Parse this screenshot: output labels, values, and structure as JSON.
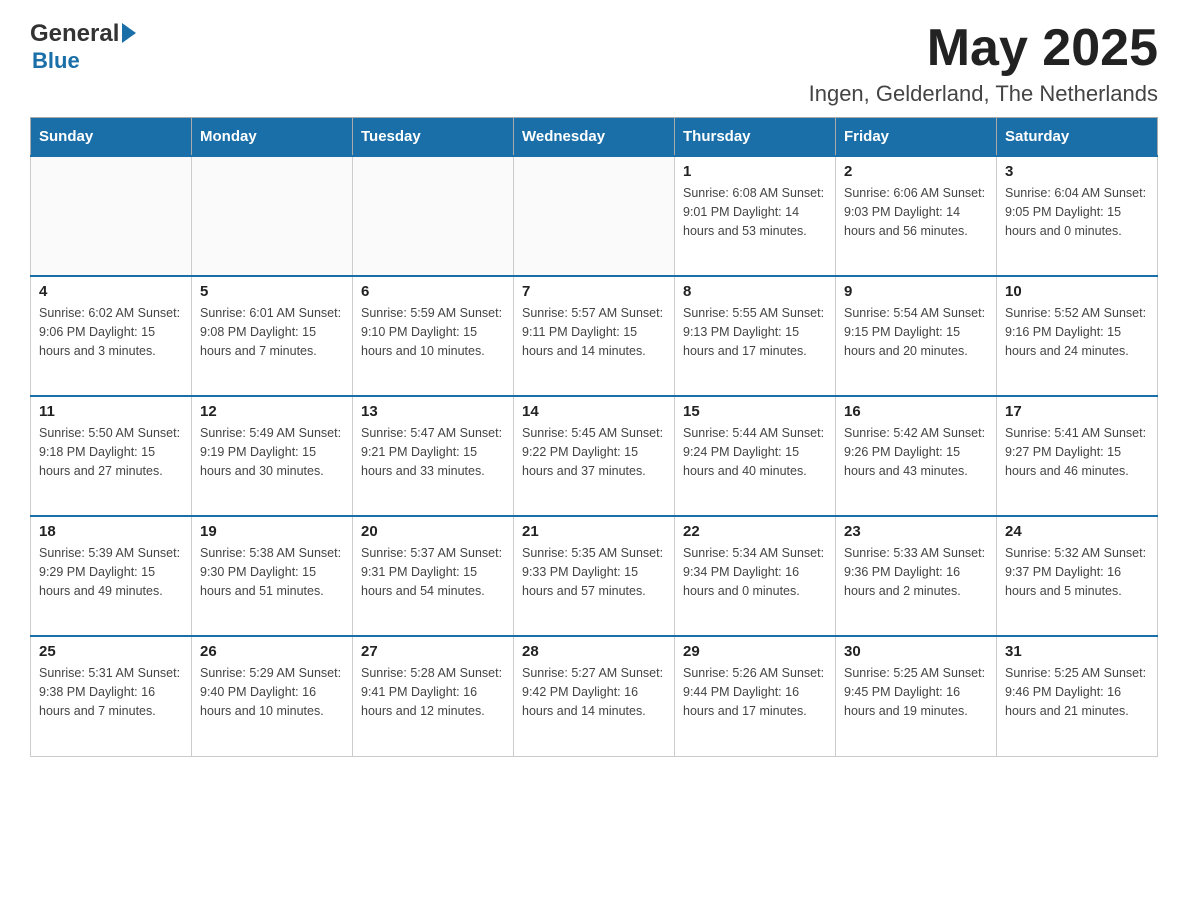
{
  "header": {
    "logo_general": "General",
    "logo_blue": "Blue",
    "title": "May 2025",
    "location": "Ingen, Gelderland, The Netherlands"
  },
  "days_of_week": [
    "Sunday",
    "Monday",
    "Tuesday",
    "Wednesday",
    "Thursday",
    "Friday",
    "Saturday"
  ],
  "weeks": [
    [
      {
        "day": "",
        "info": ""
      },
      {
        "day": "",
        "info": ""
      },
      {
        "day": "",
        "info": ""
      },
      {
        "day": "",
        "info": ""
      },
      {
        "day": "1",
        "info": "Sunrise: 6:08 AM\nSunset: 9:01 PM\nDaylight: 14 hours\nand 53 minutes."
      },
      {
        "day": "2",
        "info": "Sunrise: 6:06 AM\nSunset: 9:03 PM\nDaylight: 14 hours\nand 56 minutes."
      },
      {
        "day": "3",
        "info": "Sunrise: 6:04 AM\nSunset: 9:05 PM\nDaylight: 15 hours\nand 0 minutes."
      }
    ],
    [
      {
        "day": "4",
        "info": "Sunrise: 6:02 AM\nSunset: 9:06 PM\nDaylight: 15 hours\nand 3 minutes."
      },
      {
        "day": "5",
        "info": "Sunrise: 6:01 AM\nSunset: 9:08 PM\nDaylight: 15 hours\nand 7 minutes."
      },
      {
        "day": "6",
        "info": "Sunrise: 5:59 AM\nSunset: 9:10 PM\nDaylight: 15 hours\nand 10 minutes."
      },
      {
        "day": "7",
        "info": "Sunrise: 5:57 AM\nSunset: 9:11 PM\nDaylight: 15 hours\nand 14 minutes."
      },
      {
        "day": "8",
        "info": "Sunrise: 5:55 AM\nSunset: 9:13 PM\nDaylight: 15 hours\nand 17 minutes."
      },
      {
        "day": "9",
        "info": "Sunrise: 5:54 AM\nSunset: 9:15 PM\nDaylight: 15 hours\nand 20 minutes."
      },
      {
        "day": "10",
        "info": "Sunrise: 5:52 AM\nSunset: 9:16 PM\nDaylight: 15 hours\nand 24 minutes."
      }
    ],
    [
      {
        "day": "11",
        "info": "Sunrise: 5:50 AM\nSunset: 9:18 PM\nDaylight: 15 hours\nand 27 minutes."
      },
      {
        "day": "12",
        "info": "Sunrise: 5:49 AM\nSunset: 9:19 PM\nDaylight: 15 hours\nand 30 minutes."
      },
      {
        "day": "13",
        "info": "Sunrise: 5:47 AM\nSunset: 9:21 PM\nDaylight: 15 hours\nand 33 minutes."
      },
      {
        "day": "14",
        "info": "Sunrise: 5:45 AM\nSunset: 9:22 PM\nDaylight: 15 hours\nand 37 minutes."
      },
      {
        "day": "15",
        "info": "Sunrise: 5:44 AM\nSunset: 9:24 PM\nDaylight: 15 hours\nand 40 minutes."
      },
      {
        "day": "16",
        "info": "Sunrise: 5:42 AM\nSunset: 9:26 PM\nDaylight: 15 hours\nand 43 minutes."
      },
      {
        "day": "17",
        "info": "Sunrise: 5:41 AM\nSunset: 9:27 PM\nDaylight: 15 hours\nand 46 minutes."
      }
    ],
    [
      {
        "day": "18",
        "info": "Sunrise: 5:39 AM\nSunset: 9:29 PM\nDaylight: 15 hours\nand 49 minutes."
      },
      {
        "day": "19",
        "info": "Sunrise: 5:38 AM\nSunset: 9:30 PM\nDaylight: 15 hours\nand 51 minutes."
      },
      {
        "day": "20",
        "info": "Sunrise: 5:37 AM\nSunset: 9:31 PM\nDaylight: 15 hours\nand 54 minutes."
      },
      {
        "day": "21",
        "info": "Sunrise: 5:35 AM\nSunset: 9:33 PM\nDaylight: 15 hours\nand 57 minutes."
      },
      {
        "day": "22",
        "info": "Sunrise: 5:34 AM\nSunset: 9:34 PM\nDaylight: 16 hours\nand 0 minutes."
      },
      {
        "day": "23",
        "info": "Sunrise: 5:33 AM\nSunset: 9:36 PM\nDaylight: 16 hours\nand 2 minutes."
      },
      {
        "day": "24",
        "info": "Sunrise: 5:32 AM\nSunset: 9:37 PM\nDaylight: 16 hours\nand 5 minutes."
      }
    ],
    [
      {
        "day": "25",
        "info": "Sunrise: 5:31 AM\nSunset: 9:38 PM\nDaylight: 16 hours\nand 7 minutes."
      },
      {
        "day": "26",
        "info": "Sunrise: 5:29 AM\nSunset: 9:40 PM\nDaylight: 16 hours\nand 10 minutes."
      },
      {
        "day": "27",
        "info": "Sunrise: 5:28 AM\nSunset: 9:41 PM\nDaylight: 16 hours\nand 12 minutes."
      },
      {
        "day": "28",
        "info": "Sunrise: 5:27 AM\nSunset: 9:42 PM\nDaylight: 16 hours\nand 14 minutes."
      },
      {
        "day": "29",
        "info": "Sunrise: 5:26 AM\nSunset: 9:44 PM\nDaylight: 16 hours\nand 17 minutes."
      },
      {
        "day": "30",
        "info": "Sunrise: 5:25 AM\nSunset: 9:45 PM\nDaylight: 16 hours\nand 19 minutes."
      },
      {
        "day": "31",
        "info": "Sunrise: 5:25 AM\nSunset: 9:46 PM\nDaylight: 16 hours\nand 21 minutes."
      }
    ]
  ]
}
